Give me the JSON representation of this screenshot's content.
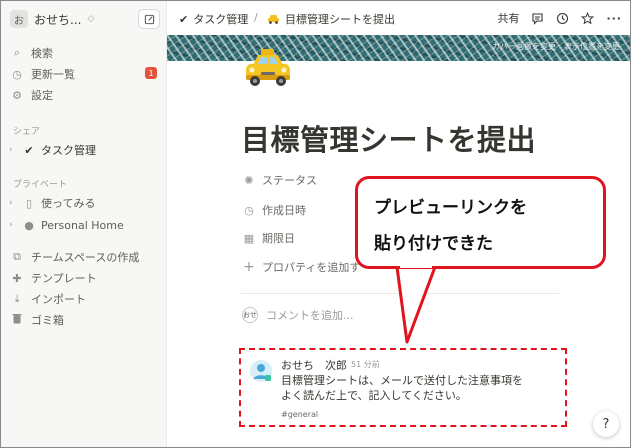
{
  "workspace": {
    "avatar_letter": "お",
    "name": "おせち..."
  },
  "sidebar": {
    "items": [
      {
        "icon": "search-icon",
        "glyph": "⌕",
        "label": "検索"
      },
      {
        "icon": "clock-icon",
        "glyph": "◷",
        "label": "更新一覧",
        "badge": "1"
      },
      {
        "icon": "gear-icon",
        "glyph": "⚙",
        "label": "設定"
      }
    ],
    "share_header": "シェア",
    "share_pages": [
      {
        "label": "タスク管理"
      }
    ],
    "private_header": "プライベート",
    "private_pages": [
      {
        "label": "使ってみる"
      },
      {
        "label": "Personal Home"
      }
    ],
    "bottom_items": [
      {
        "icon": "teamspace-icon",
        "glyph": "⧉",
        "label": "チームスペースの作成"
      },
      {
        "icon": "template-icon",
        "glyph": "✚",
        "label": "テンプレート"
      },
      {
        "icon": "import-icon",
        "glyph": "⤓",
        "label": "インポート"
      },
      {
        "icon": "trash-icon",
        "glyph": "🗑",
        "label": "ゴミ箱"
      }
    ]
  },
  "topbar": {
    "breadcrumb_parent": "タスク管理",
    "breadcrumb_sep": "/",
    "breadcrumb_current": "目標管理シートを提出",
    "share_label": "共有"
  },
  "cover": {
    "actions": "カバー画像を変更　表示位置を変更"
  },
  "page": {
    "title": "目標管理シートを提出",
    "properties": [
      {
        "icon": "status-icon",
        "glyph": "✺",
        "label": "ステータス"
      },
      {
        "icon": "calendar-clock-icon",
        "glyph": "◷",
        "label": "作成日時"
      },
      {
        "icon": "calendar-icon",
        "glyph": "▦",
        "label": "期限日"
      },
      {
        "icon": "plus-icon",
        "glyph": "+",
        "label": "プロパティを追加す"
      }
    ],
    "comment_avatar": "おせ",
    "comment_placeholder": "コメントを追加..."
  },
  "preview": {
    "author": "おせち　次郎",
    "time": "51 分前",
    "body": "目標管理シートは、メールで送付した注意事項を\nよく読んだ上で、記入してください。",
    "tag": "#general"
  },
  "callout": {
    "line1": "プレビューリンクを",
    "line2": "貼り付けできた"
  },
  "help": {
    "label": "?"
  },
  "colors": {
    "annotation_red": "#e0141e",
    "sidebar_bg": "#f7f7f5",
    "badge_red": "#e5533d",
    "cover_teal": "#2f6e78"
  }
}
